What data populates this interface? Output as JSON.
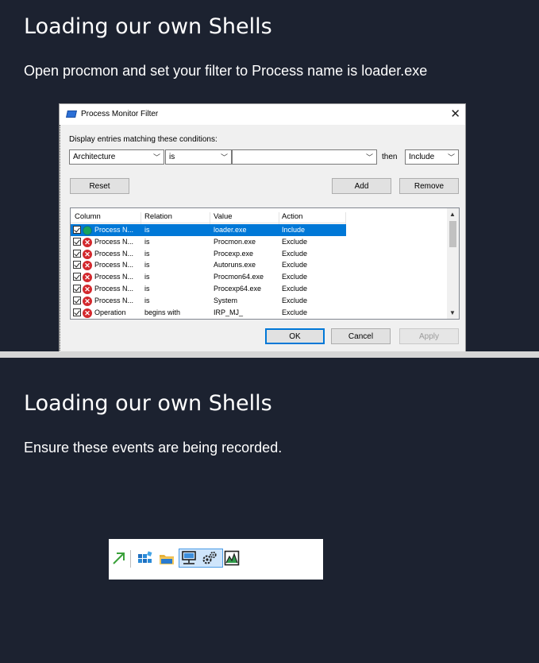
{
  "slide1": {
    "title": "Loading our own Shells",
    "instruction": "Open procmon and set your filter to Process name is  loader.exe",
    "dialog": {
      "title": "Process Monitor Filter",
      "close_icon": "close-icon",
      "conditions_label": "Display entries matching these conditions:",
      "column_select": "Architecture",
      "relation_select": "is",
      "value_input": "",
      "then_label": "then",
      "action_select": "Include",
      "reset_label": "Reset",
      "add_label": "Add",
      "remove_label": "Remove",
      "headers": [
        "Column",
        "Relation",
        "Value",
        "Action"
      ],
      "rows": [
        {
          "column": "Process N...",
          "relation": "is",
          "value": "loader.exe",
          "action": "Include",
          "status": "include",
          "selected": true
        },
        {
          "column": "Process N...",
          "relation": "is",
          "value": "Procmon.exe",
          "action": "Exclude",
          "status": "exclude",
          "selected": false
        },
        {
          "column": "Process N...",
          "relation": "is",
          "value": "Procexp.exe",
          "action": "Exclude",
          "status": "exclude",
          "selected": false
        },
        {
          "column": "Process N...",
          "relation": "is",
          "value": "Autoruns.exe",
          "action": "Exclude",
          "status": "exclude",
          "selected": false
        },
        {
          "column": "Process N...",
          "relation": "is",
          "value": "Procmon64.exe",
          "action": "Exclude",
          "status": "exclude",
          "selected": false
        },
        {
          "column": "Process N...",
          "relation": "is",
          "value": "Procexp64.exe",
          "action": "Exclude",
          "status": "exclude",
          "selected": false
        },
        {
          "column": "Process N...",
          "relation": "is",
          "value": "System",
          "action": "Exclude",
          "status": "exclude",
          "selected": false
        },
        {
          "column": "Operation",
          "relation": "begins with",
          "value": "IRP_MJ_",
          "action": "Exclude",
          "status": "exclude",
          "selected": false
        }
      ],
      "ok_label": "OK",
      "cancel_label": "Cancel",
      "apply_label": "Apply"
    }
  },
  "slide2": {
    "title": "Loading our own Shells",
    "instruction": "Ensure these events are being recorded.",
    "toolbar_icons": [
      "jump-arrow-icon",
      "registry-activity-icon",
      "file-system-activity-icon",
      "network-activity-icon",
      "process-thread-activity-icon",
      "profiling-events-icon"
    ]
  },
  "colors": {
    "slide_background": "#1c2230",
    "selection": "#0078d7",
    "exclude_icon": "#d3282d",
    "include_icon": "#19a35b"
  }
}
